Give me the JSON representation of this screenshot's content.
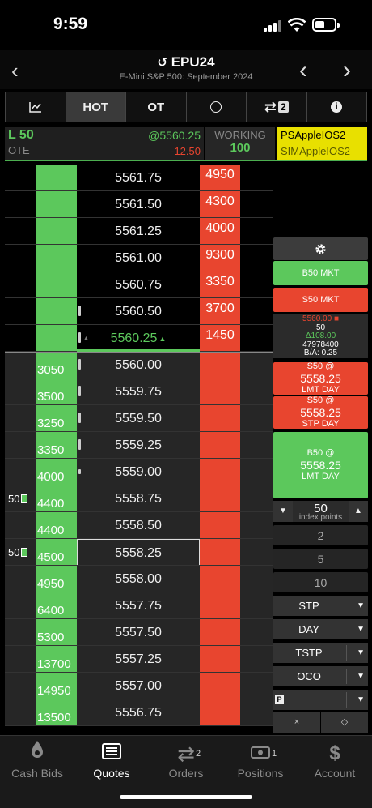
{
  "status": {
    "time": "9:59"
  },
  "header": {
    "title": "EPU24",
    "subtitle": "E-Mini S&P 500: September 2024",
    "back": "‹",
    "prev": "‹",
    "next": "›"
  },
  "toolbar": {
    "hot": "HOT",
    "ot": "OT",
    "routes_count": "2"
  },
  "info": {
    "position": "L 50",
    "ote_label": "OTE",
    "avg_price": "@5560.25",
    "pnl": "-12.50",
    "working_label": "WORKING",
    "working_qty": "100",
    "account_1": "PSAppleIOS2",
    "account_2": "SIMAppleIOS2"
  },
  "ladder": [
    {
      "price": "5561.75",
      "ask": "4950",
      "bid": "",
      "working": ""
    },
    {
      "price": "5561.50",
      "ask": "4300",
      "bid": "",
      "working": ""
    },
    {
      "price": "5561.25",
      "ask": "4000",
      "bid": "",
      "working": ""
    },
    {
      "price": "5561.00",
      "ask": "9300",
      "bid": "",
      "working": ""
    },
    {
      "price": "5560.75",
      "ask": "3350",
      "bid": "",
      "working": ""
    },
    {
      "price": "5560.50",
      "ask": "3700",
      "bid": "",
      "working": ""
    },
    {
      "price": "5560.25",
      "ask": "1450",
      "bid": "",
      "working": ""
    },
    {
      "price": "5560.00",
      "ask": "",
      "bid": "3050",
      "working": ""
    },
    {
      "price": "5559.75",
      "ask": "",
      "bid": "3500",
      "working": ""
    },
    {
      "price": "5559.50",
      "ask": "",
      "bid": "3250",
      "working": ""
    },
    {
      "price": "5559.25",
      "ask": "",
      "bid": "3350",
      "working": ""
    },
    {
      "price": "5559.00",
      "ask": "",
      "bid": "4000",
      "working": ""
    },
    {
      "price": "5558.75",
      "ask": "",
      "bid": "4400",
      "working": "50"
    },
    {
      "price": "5558.50",
      "ask": "",
      "bid": "4400",
      "working": ""
    },
    {
      "price": "5558.25",
      "ask": "",
      "bid": "4500",
      "working": "50"
    },
    {
      "price": "5558.00",
      "ask": "",
      "bid": "4950",
      "working": ""
    },
    {
      "price": "5557.75",
      "ask": "",
      "bid": "6400",
      "working": ""
    },
    {
      "price": "5557.50",
      "ask": "",
      "bid": "5300",
      "working": ""
    },
    {
      "price": "5557.25",
      "ask": "",
      "bid": "13700",
      "working": ""
    },
    {
      "price": "5557.00",
      "ask": "",
      "bid": "14950",
      "working": ""
    },
    {
      "price": "5556.75",
      "ask": "",
      "bid": "13500",
      "working": ""
    }
  ],
  "last_trade_arrow": "▲",
  "last_trade_prev_arrow": "▲",
  "panel": {
    "buy_market": "B50 MKT",
    "sell_market": "S50 MKT",
    "stats": {
      "last": "5560.00 ■",
      "last_size": "50",
      "change": "Δ108.00",
      "volume": "47978400",
      "spread": "B/A: 0.25"
    },
    "order1": {
      "line1": "S50 @",
      "price": "5558.25",
      "type": "LMT DAY"
    },
    "order2": {
      "line1": "S50 @",
      "price": "5558.25",
      "type": "STP DAY"
    },
    "order3": {
      "line1": "B50 @",
      "price": "5558.25",
      "type": "LMT DAY"
    },
    "qty": "50",
    "qty_unit": "index points",
    "presets": [
      "2",
      "5",
      "10"
    ],
    "order_type": "STP",
    "duration": "DAY",
    "trailing": "TSTP",
    "oco": "OCO",
    "p_label": "P",
    "collapse": "×",
    "expand": "◇"
  },
  "tabs": [
    {
      "label": "Cash Bids",
      "badge": ""
    },
    {
      "label": "Quotes",
      "badge": ""
    },
    {
      "label": "Orders",
      "badge": "2"
    },
    {
      "label": "Positions",
      "badge": "1"
    },
    {
      "label": "Account",
      "badge": ""
    }
  ],
  "colors": {
    "bid": "#5cc85c",
    "ask": "#e8452f",
    "accent": "#e8e000"
  }
}
